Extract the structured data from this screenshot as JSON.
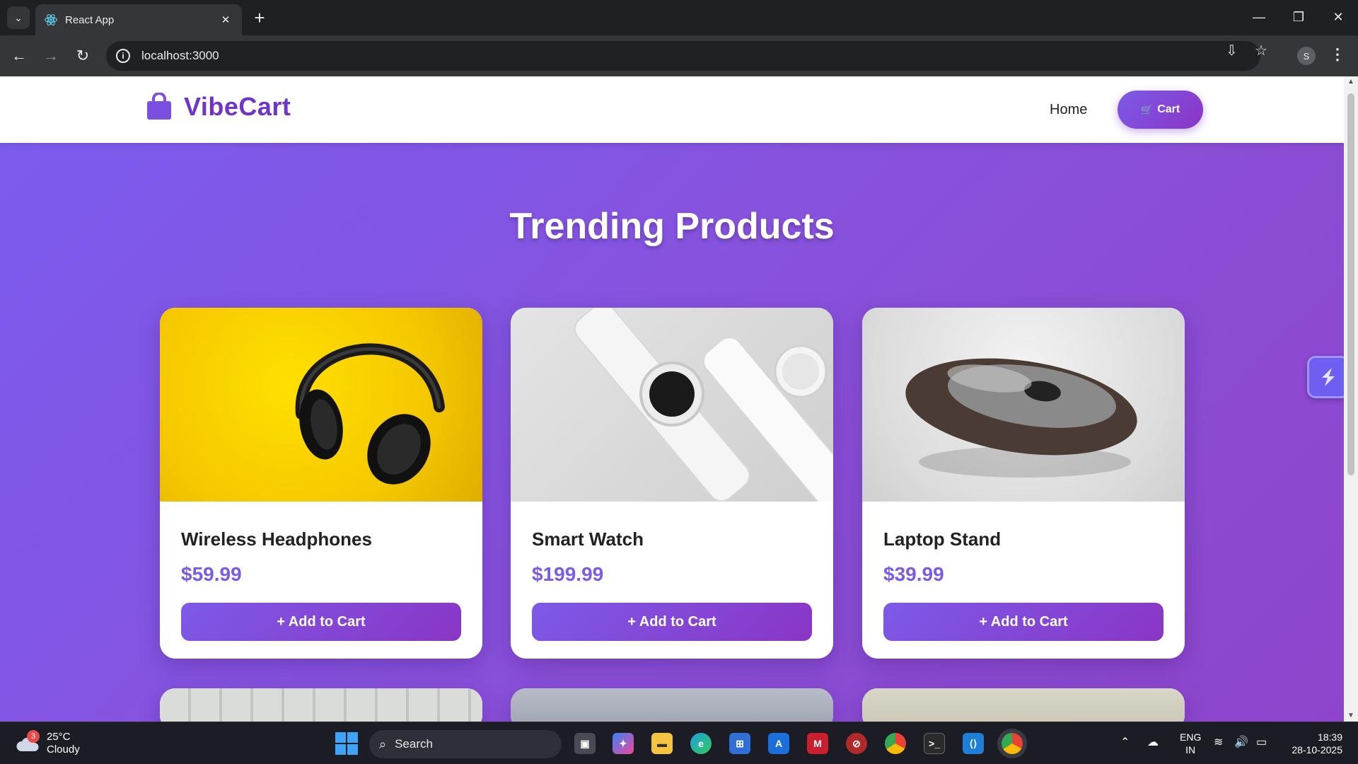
{
  "browser": {
    "tab_title": "React App",
    "url": "localhost:3000",
    "profile_initial": "S"
  },
  "site": {
    "brand": "VibeCart",
    "nav_home": "Home",
    "cart_label": "Cart",
    "section_title": "Trending Products"
  },
  "products": [
    {
      "name": "Wireless Headphones",
      "price": "$59.99",
      "button": "+ Add to Cart"
    },
    {
      "name": "Smart Watch",
      "price": "$199.99",
      "button": "+ Add to Cart"
    },
    {
      "name": "Laptop Stand",
      "price": "$39.99",
      "button": "+ Add to Cart"
    }
  ],
  "taskbar": {
    "weather_temp": "25°C",
    "weather_cond": "Cloudy",
    "weather_badge": "3",
    "search_label": "Search",
    "lang_top": "ENG",
    "lang_bottom": "IN",
    "time": "18:39",
    "date": "28-10-2025"
  },
  "colors": {
    "accent": "#7b5ae6",
    "brand": "#6f34c9",
    "page_gradient_start": "#7b5cf0",
    "page_gradient_end": "#8e45cc"
  }
}
